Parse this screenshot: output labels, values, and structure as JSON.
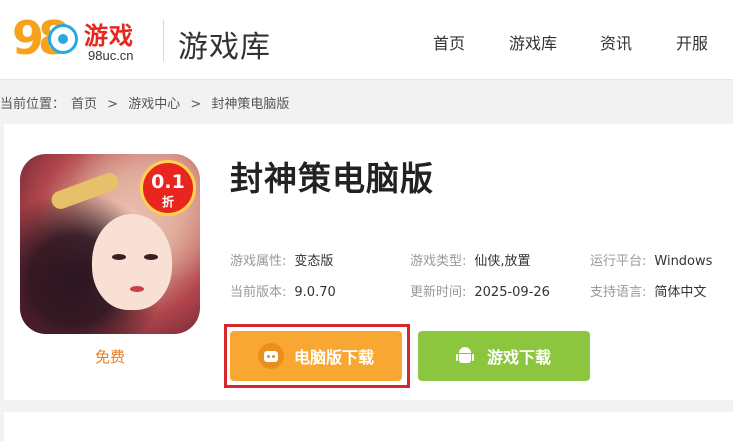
{
  "site": {
    "logo_number": "98",
    "logo_name": "游戏",
    "logo_domain": "98uc.cn",
    "section_title": "游戏库"
  },
  "nav": [
    {
      "label": "首页"
    },
    {
      "label": "游戏库"
    },
    {
      "label": "资讯"
    },
    {
      "label": "开服"
    }
  ],
  "breadcrumb": {
    "prefix": "当前位置：",
    "items": [
      "首页",
      "游戏中心",
      "封神策电脑版"
    ],
    "separator": ">"
  },
  "game": {
    "title": "封神策电脑版",
    "price": "免费",
    "discount": "0.1",
    "discount_unit": "折",
    "info": {
      "attr_label": "游戏属性:",
      "attr_value": "变态版",
      "type_label": "游戏类型:",
      "type_value": "仙侠,放置",
      "platform_label": "运行平台:",
      "platform_value": "Windows",
      "version_label": "当前版本:",
      "version_value": "9.0.70",
      "updated_label": "更新时间:",
      "updated_value": "2025-09-26",
      "lang_label": "支持语言:",
      "lang_value": "简体中文"
    }
  },
  "buttons": {
    "pc_download": "电脑版下载",
    "game_download": "游戏下载"
  },
  "colors": {
    "pc_button": "#f7a732",
    "game_button": "#8cc63e",
    "highlight": "#d8262d",
    "price": "#e67e22"
  }
}
